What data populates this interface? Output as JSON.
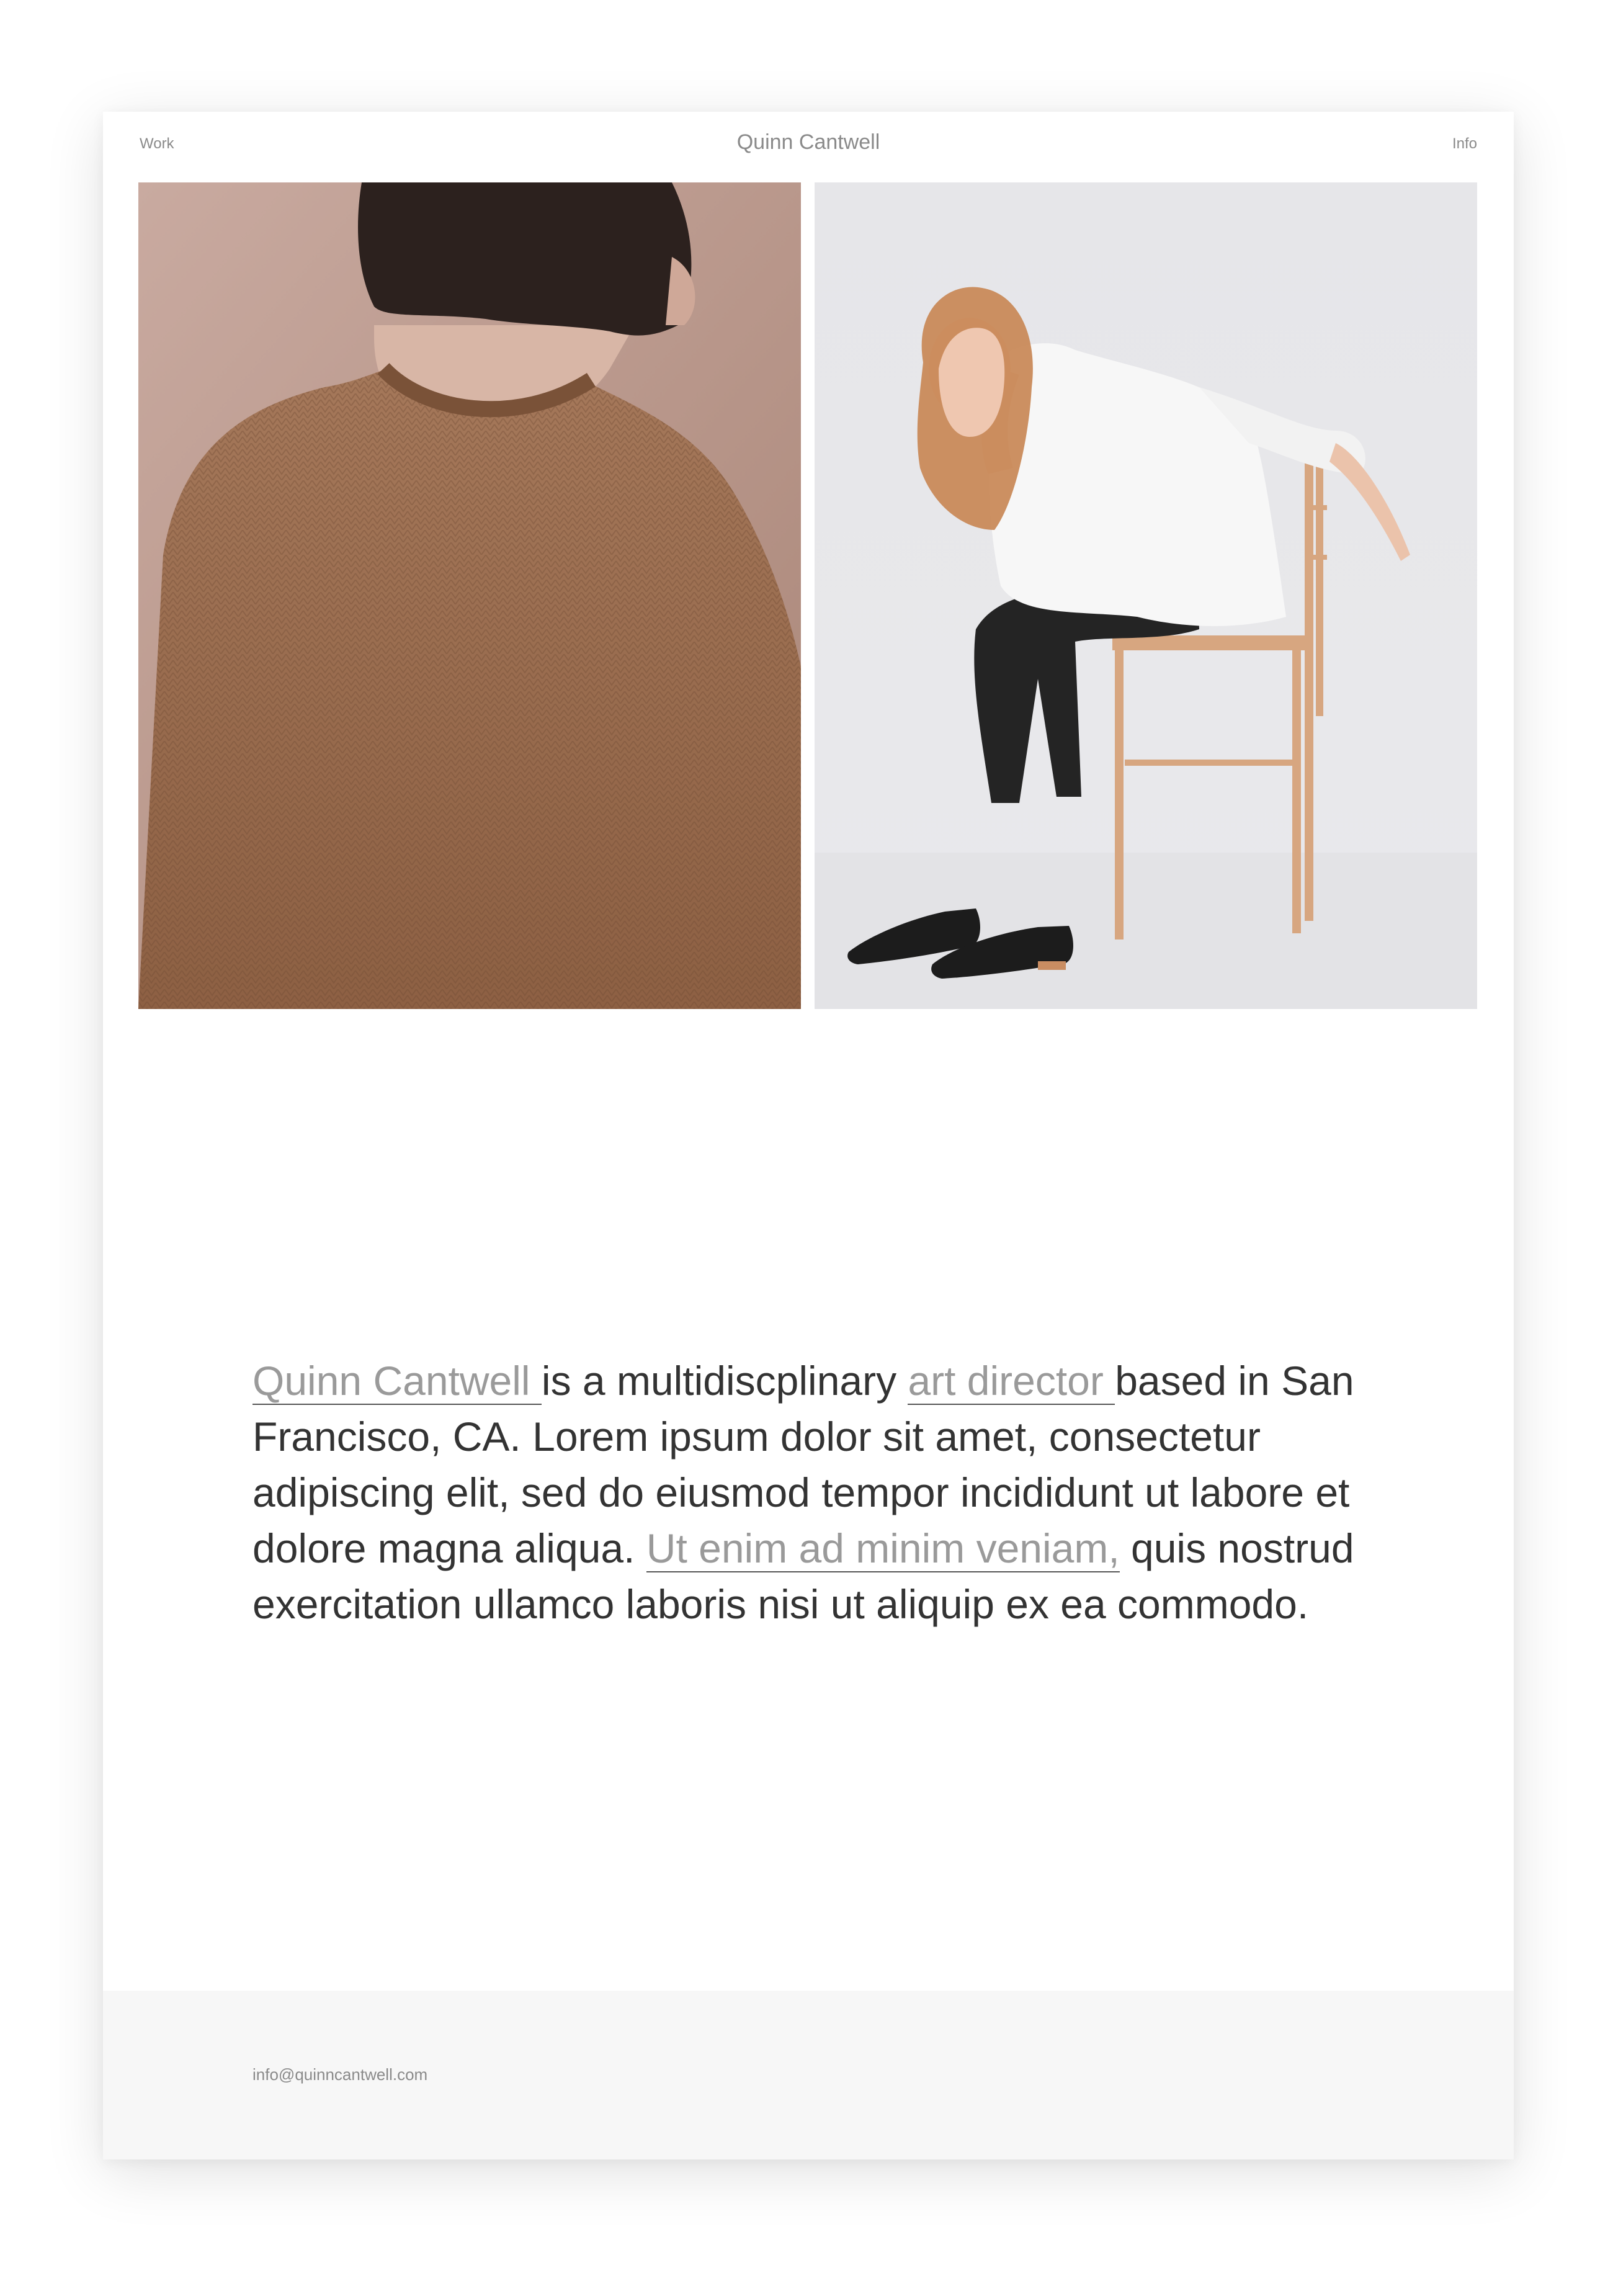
{
  "header": {
    "work_label": "Work",
    "title": "Quinn Cantwell",
    "info_label": "Info"
  },
  "gallery": [
    {
      "subject": "woman-in-knit-sweater-photo"
    },
    {
      "subject": "woman-seated-on-wooden-stool-photo"
    }
  ],
  "bio": {
    "name_link": "Quinn Cantwell ",
    "text_1": "is a multidiscplinary ",
    "role_link": "art director ",
    "text_2": "based in San Francisco, CA. Lorem ipsum dolor sit amet, consectetur adipiscing elit, sed do eiusmod tempor incididunt ut labore et dolore magna aliqua. ",
    "link_3": "Ut enim ad minim veniam,",
    "text_3": " quis nostrud exercitation ullamco laboris nisi ut aliquip ex ea commodo."
  },
  "footer": {
    "email": "info@quinncantwell.com"
  },
  "colors": {
    "text": "#333333",
    "muted": "#8a8a8a",
    "link": "#9a9a9a",
    "footer_bg": "#f7f7f7"
  }
}
